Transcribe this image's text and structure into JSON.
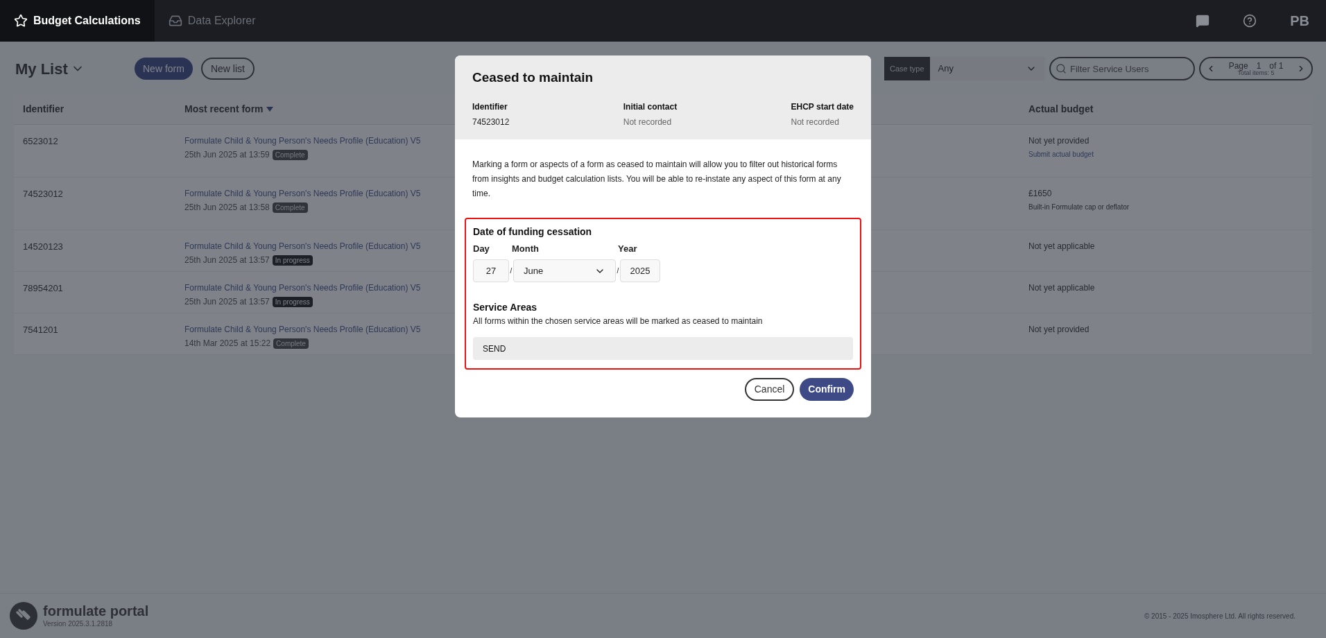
{
  "nav": {
    "tabs": [
      {
        "label": "Budget Calculations",
        "selected": true,
        "kind": "star"
      },
      {
        "label": "Data Explorer",
        "selected": false,
        "kind": "inbox"
      }
    ],
    "user_initials": "PB"
  },
  "toolbar": {
    "title": "My List",
    "buttons": [
      {
        "label": "New form",
        "primary": true
      },
      {
        "label": "New list",
        "primary": false
      }
    ],
    "case_type": {
      "label": "Case type",
      "value": "Any"
    },
    "search": {
      "placeholder": "Filter Service Users"
    },
    "pager": {
      "label": "Page",
      "page": "1",
      "of": "of 1",
      "total": "Total items: 5"
    }
  },
  "table": {
    "columns": [
      "Identifier",
      "Most recent form",
      "Actual budget"
    ],
    "rows": [
      {
        "identifier": "6523012",
        "form": "Formulate Child & Young Person's Needs Profile (Education) V5",
        "date": "25th Jun 2025 at 13:59",
        "status": {
          "label": "Complete",
          "kind": "complete"
        },
        "budget": "Not yet provided",
        "budget_note": {
          "text": "Submit actual budget",
          "kind": "link"
        }
      },
      {
        "identifier": "74523012",
        "form": "Formulate Child & Young Person's Needs Profile (Education) V5",
        "date": "25th Jun 2025 at 13:58",
        "status": {
          "label": "Complete",
          "kind": "complete"
        },
        "budget": "£1650",
        "budget_note": {
          "text": "Built-in Formulate cap or deflator",
          "kind": "text"
        }
      },
      {
        "identifier": "14520123",
        "form": "Formulate Child & Young Person's Needs Profile (Education) V5",
        "date": "25th Jun 2025 at 13:57",
        "status": {
          "label": "In progress",
          "kind": "in_progress"
        },
        "budget": "Not yet applicable"
      },
      {
        "identifier": "78954201",
        "form": "Formulate Child & Young Person's Needs Profile (Education) V5",
        "date": "25th Jun 2025 at 13:57",
        "status": {
          "label": "In progress",
          "kind": "in_progress"
        },
        "budget": "Not yet applicable"
      },
      {
        "identifier": "7541201",
        "form": "Formulate Child & Young Person's Needs Profile (Education) V5",
        "date": "14th Mar 2025 at 15:22",
        "status": {
          "label": "Complete",
          "kind": "complete"
        },
        "budget": "Not yet provided"
      }
    ]
  },
  "modal": {
    "title": "Ceased to maintain",
    "meta": [
      {
        "label": "Identifier",
        "value": "74523012",
        "muted": false
      },
      {
        "label": "Initial contact",
        "value": "Not recorded",
        "muted": true
      },
      {
        "label": "EHCP start date",
        "value": "Not recorded",
        "muted": true
      }
    ],
    "description": "Marking a form or aspects of a form as ceased to maintain will allow you to filter out historical forms from insights and budget calculation lists. You will be able to re-instate any aspect of this form at any time.",
    "highlighted": true,
    "date": {
      "title": "Date of funding cessation",
      "day_label": "Day",
      "month_label": "Month",
      "year_label": "Year",
      "day": "27",
      "month": "June",
      "year": "2025",
      "separators": [
        "/",
        "/"
      ]
    },
    "service_areas": {
      "title": "Service Areas",
      "hint": "All forms within the chosen service areas will be marked as ceased to maintain",
      "value": "SEND"
    },
    "buttons": {
      "cancel": "Cancel",
      "confirm": "Confirm"
    }
  },
  "footer": {
    "product": "formulate portal",
    "version": "Version 2025.3.1.2818",
    "copyright": "© 2015 - 2025 Imosphere Ltd. All rights reserved."
  }
}
